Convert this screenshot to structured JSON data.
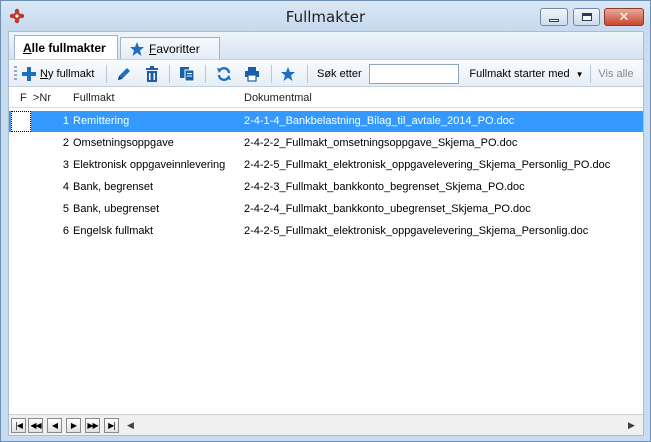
{
  "window": {
    "title": "Fullmakter"
  },
  "tabs": [
    {
      "label_u": "A",
      "label_rest": "lle fullmakter",
      "active": true
    },
    {
      "label_u": "F",
      "label_rest": "avoritter",
      "active": false
    }
  ],
  "toolbar": {
    "new_label_u": "N",
    "new_label_rest": "y fullmakt",
    "search_label": "Søk etter",
    "search_value": "",
    "filter_selected": "Fullmakt starter med",
    "show_all_label": "Vis alle"
  },
  "grid": {
    "columns": [
      "F",
      ">Nr",
      "Fullmakt",
      "Dokumentmal"
    ],
    "rows": [
      {
        "nr": "1",
        "fullmakt": "Remittering",
        "dokumentmal": "2-4-1-4_Bankbelastning_Bilag_til_avtale_2014_PO.doc",
        "selected": true
      },
      {
        "nr": "2",
        "fullmakt": "Omsetningsoppgave",
        "dokumentmal": "2-4-2-2_Fullmakt_omsetningsoppgave_Skjema_PO.doc",
        "selected": false
      },
      {
        "nr": "3",
        "fullmakt": "Elektronisk oppgaveinnlevering",
        "dokumentmal": "2-4-2-5_Fullmakt_elektronisk_oppgavelevering_Skjema_Personlig_PO.doc",
        "selected": false
      },
      {
        "nr": "4",
        "fullmakt": "Bank, begrenset",
        "dokumentmal": "2-4-2-3_Fullmakt_bankkonto_begrenset_Skjema_PO.doc",
        "selected": false
      },
      {
        "nr": "5",
        "fullmakt": "Bank, ubegrenset",
        "dokumentmal": "2-4-2-4_Fullmakt_bankkonto_ubegrenset_Skjema_PO.doc",
        "selected": false
      },
      {
        "nr": "6",
        "fullmakt": "Engelsk fullmakt",
        "dokumentmal": "2-4-2-5_Fullmakt_elektronisk_oppgavelevering_Skjema_Personlig.doc",
        "selected": false
      }
    ]
  },
  "colors": {
    "selection": "#3399ff",
    "toolbar_icons": "#1f6fc1",
    "delete_icon": "#1a5fa8"
  }
}
